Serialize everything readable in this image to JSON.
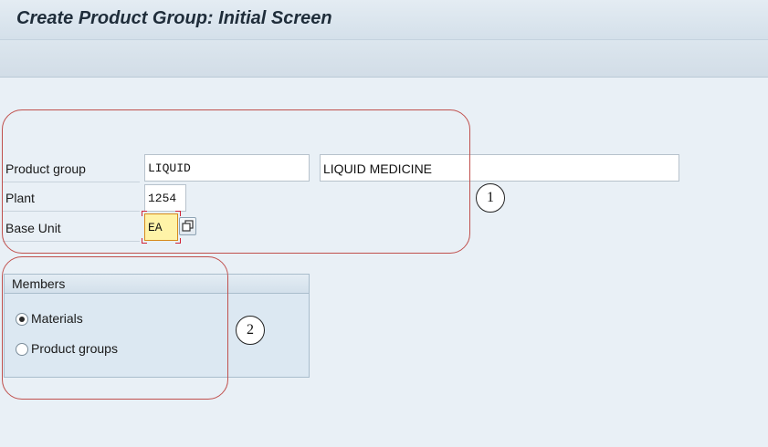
{
  "window": {
    "title": "Create Product Group: Initial Screen"
  },
  "form": {
    "product_group": {
      "label": "Product group",
      "value": "LIQUID",
      "description": "LIQUID MEDICINE"
    },
    "plant": {
      "label": "Plant",
      "value": "1254"
    },
    "base_unit": {
      "label": "Base Unit",
      "value": "EA",
      "help_icon": "value-help-icon"
    }
  },
  "members": {
    "title": "Members",
    "options": [
      {
        "label": "Materials",
        "selected": true
      },
      {
        "label": "Product groups",
        "selected": false
      }
    ]
  },
  "annotations": {
    "marker_1": "1",
    "marker_2": "2",
    "box_color": "#c0504d"
  },
  "colors": {
    "background": "#e9f0f6",
    "required_field": "#fff3a8"
  }
}
